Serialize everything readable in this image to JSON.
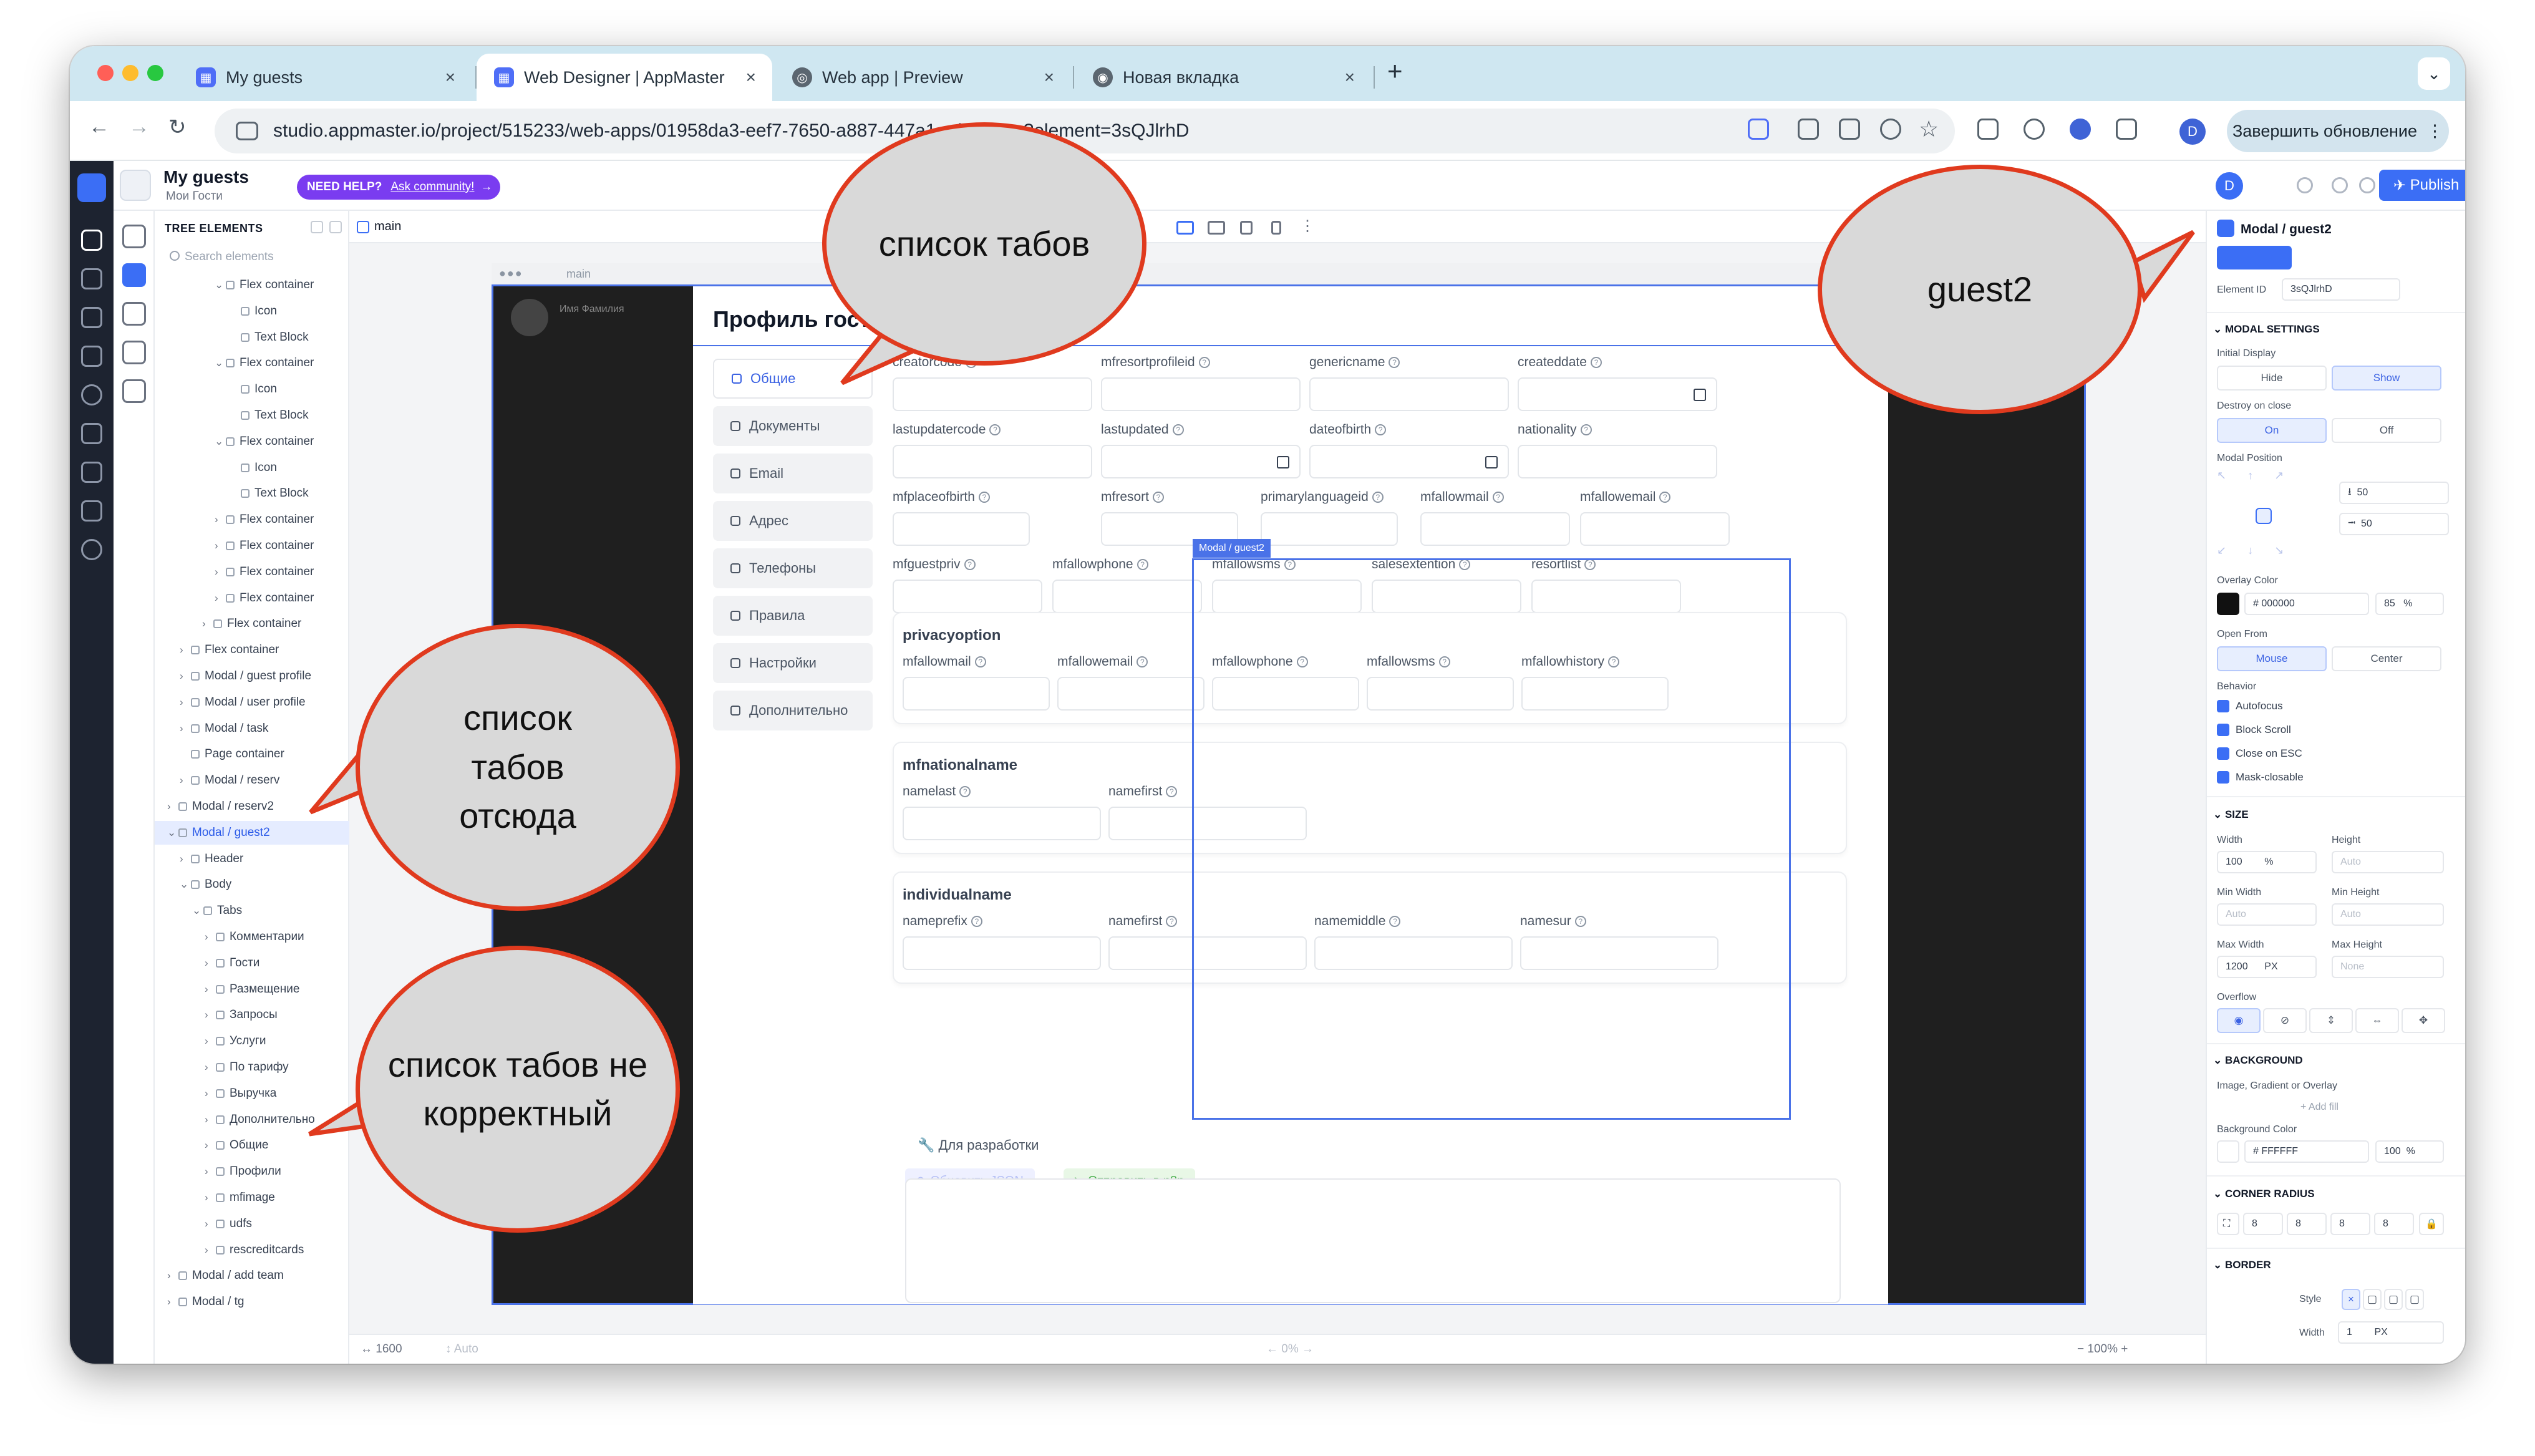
{
  "browser": {
    "tabs": [
      {
        "title": "My guests",
        "icon": "appmaster-icon"
      },
      {
        "title": "Web Designer | AppMaster",
        "icon": "appmaster-icon"
      },
      {
        "title": "Web app | Preview",
        "icon": "globe-icon"
      },
      {
        "title": "Новая вкладка",
        "icon": "chrome-icon"
      }
    ],
    "url": "studio.appmaster.io/project/515233/web-apps/01958da3-eef7-7650-a887-447a1...designer?element=3sQJlrhD",
    "update_button": "Завершить обновление",
    "profile_initial": "D"
  },
  "app": {
    "title": "My guests",
    "subtitle": "Мои Гости",
    "help_label": "NEED HELP?",
    "help_link": "Ask community!",
    "publish_label": "Publish",
    "avatar_initial": "D"
  },
  "tree": {
    "header": "TREE ELEMENTS",
    "search_placeholder": "Search elements",
    "rows": [
      {
        "label": "Flex container",
        "arrow": "v"
      },
      {
        "label": "Icon",
        "arrow": ""
      },
      {
        "label": "Text Block",
        "arrow": ""
      },
      {
        "label": "Flex container",
        "arrow": "v"
      },
      {
        "label": "Icon",
        "arrow": ""
      },
      {
        "label": "Text Block",
        "arrow": ""
      },
      {
        "label": "Flex container",
        "arrow": "v"
      },
      {
        "label": "Icon",
        "arrow": ""
      },
      {
        "label": "Text Block",
        "arrow": ""
      },
      {
        "label": "Flex container",
        "arrow": ">"
      },
      {
        "label": "Flex container",
        "arrow": ">"
      },
      {
        "label": "Flex container",
        "arrow": ">"
      },
      {
        "label": "Flex container",
        "arrow": ">"
      },
      {
        "label": "Flex container",
        "arrow": ">"
      },
      {
        "label": "Flex container",
        "arrow": ">"
      },
      {
        "label": "Modal / guest profile",
        "arrow": ">"
      },
      {
        "label": "Modal / user profile",
        "arrow": ">"
      },
      {
        "label": "Modal / task",
        "arrow": ">"
      },
      {
        "label": "Page container",
        "arrow": ""
      },
      {
        "label": "Modal / reserv",
        "arrow": ">"
      },
      {
        "label": "Modal / reserv2",
        "arrow": ">"
      },
      {
        "label": "Modal / guest2",
        "arrow": "v"
      },
      {
        "label": "Header",
        "arrow": ">"
      },
      {
        "label": "Body",
        "arrow": "v"
      },
      {
        "label": "Tabs",
        "arrow": "v"
      },
      {
        "label": "Комментарии",
        "arrow": ">"
      },
      {
        "label": "Гости",
        "arrow": ">"
      },
      {
        "label": "Размещение",
        "arrow": ">"
      },
      {
        "label": "Запросы",
        "arrow": ">"
      },
      {
        "label": "Услуги",
        "arrow": ">"
      },
      {
        "label": "По тарифу",
        "arrow": ">"
      },
      {
        "label": "Выручка",
        "arrow": ">"
      },
      {
        "label": "Дополнительно",
        "arrow": ">"
      },
      {
        "label": "Общие",
        "arrow": ">"
      },
      {
        "label": "Профили",
        "arrow": ">"
      },
      {
        "label": "mfimage",
        "arrow": ">"
      },
      {
        "label": "udfs",
        "arrow": ">"
      },
      {
        "label": "rescreditcards",
        "arrow": ">"
      },
      {
        "label": "Modal / add team",
        "arrow": ">"
      },
      {
        "label": "Modal / tg",
        "arrow": ">"
      }
    ]
  },
  "canvas": {
    "tab_label": "main",
    "frame_label": "main",
    "side_user": "Имя Фамилия",
    "bottom": {
      "width": "1600",
      "height": "Auto",
      "spacing": "0%",
      "zoom": "100%"
    }
  },
  "modal": {
    "title": "Профиль гостя",
    "selection_tag": "Modal / guest2",
    "tabs": [
      "Общие",
      "Документы",
      "Email",
      "Адрес",
      "Телефоны",
      "Правила",
      "Настройки",
      "Дополнительно"
    ],
    "rows": [
      [
        "creatorcode",
        "mfresortprofileid",
        "genericname",
        "createddate"
      ],
      [
        "lastupdatercode",
        "lastupdated",
        "dateofbirth",
        "nationality"
      ],
      [
        "mfplaceofbirth",
        "mfresort",
        "primarylanguageid",
        "mfallowmail",
        "mfallowemail"
      ],
      [
        "mfguestpriv",
        "mfallowphone",
        "mfallowsms",
        "salesextention",
        "resortlist"
      ]
    ],
    "sections": [
      {
        "title": "privacyoption",
        "fields": [
          "mfallowmail",
          "mfallowemail",
          "mfallowphone",
          "mfallowsms",
          "mfallowhistory"
        ]
      },
      {
        "title": "mfnationalname",
        "fields": [
          "namelast",
          "namefirst"
        ]
      },
      {
        "title": "individualname",
        "fields": [
          "nameprefix",
          "namefirst",
          "namemiddle",
          "namesur"
        ]
      }
    ],
    "dev_label": "Для разработки",
    "refresh_json": "Обновить JSON",
    "send_n8n": "Отправить в n8n"
  },
  "props": {
    "title": "Modal / guest2",
    "element_id_label": "Element ID",
    "element_id": "3sQJlrhD",
    "modal_settings": "MODAL SETTINGS",
    "initial_display": "Initial Display",
    "hide": "Hide",
    "show": "Show",
    "destroy_on_close": "Destroy on close",
    "on": "On",
    "off": "Off",
    "modal_position": "Modal Position",
    "pos_x": "50",
    "pos_y": "50",
    "overlay_color": "Overlay Color",
    "overlay_hex": "# 000000",
    "overlay_opacity": "85",
    "percent": "%",
    "open_from": "Open From",
    "mouse": "Mouse",
    "center": "Center",
    "behavior": "Behavior",
    "checks": [
      "Autofocus",
      "Block Scroll",
      "Close on ESC",
      "Mask-closable"
    ],
    "size": "SIZE",
    "width": "Width",
    "height": "Height",
    "width_val": "100",
    "height_val": "Auto",
    "min_width": "Min Width",
    "min_height": "Min Height",
    "min_width_val": "Auto",
    "min_height_val": "Auto",
    "max_width": "Max Width",
    "max_height": "Max Height",
    "max_width_val": "1200",
    "px": "PX",
    "max_height_val": "None",
    "overflow": "Overflow",
    "background": "BACKGROUND",
    "bg_image": "Image, Gradient or Overlay",
    "add_fill": "+ Add fill",
    "bg_color": "Background Color",
    "bg_hex": "# FFFFFF",
    "bg_opacity": "100",
    "corner_radius": "CORNER RADIUS",
    "radii": [
      "8",
      "8",
      "8",
      "8"
    ],
    "border": "BORDER",
    "style": "Style",
    "border_width": "1"
  },
  "annotations": {
    "tabs_list": "список табов",
    "guest2": "guest2",
    "tabs_from_here": "список табов отсюда",
    "tabs_incorrect": "список табов не корректный"
  },
  "colors": {
    "accent": "#3b6ef5",
    "help_pill": "#7a3cf0",
    "bubble_fill": "#d9d9d9",
    "bubble_stroke": "#e03a1e",
    "rail": "#1d2330"
  }
}
